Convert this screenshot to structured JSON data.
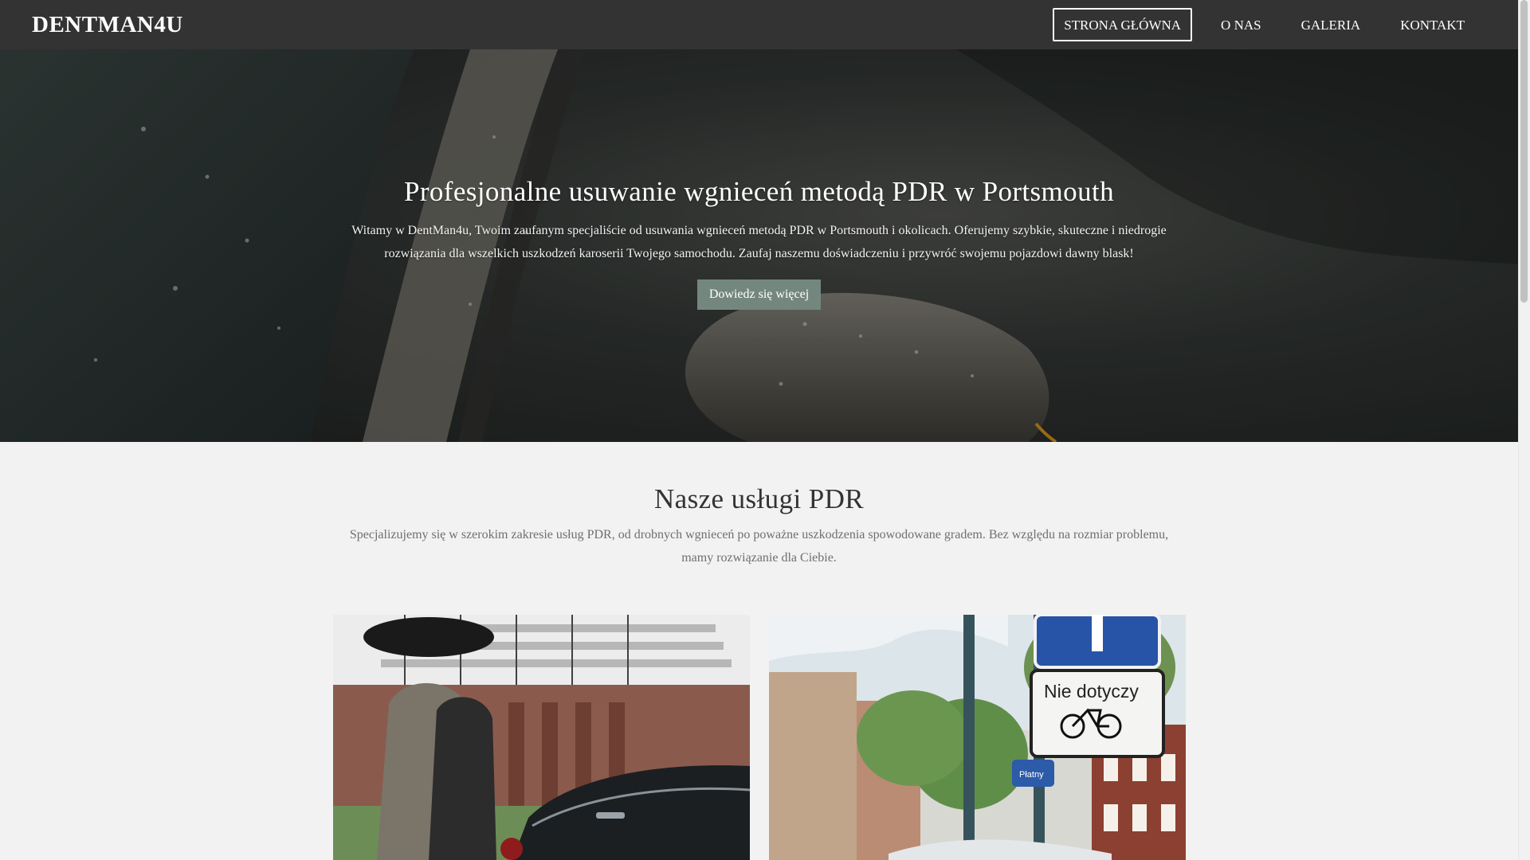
{
  "brand": {
    "name": "DENTMAN4U"
  },
  "nav": {
    "items": [
      {
        "label": "STRONA GŁÓWNA",
        "active": true
      },
      {
        "label": "O NAS",
        "active": false
      },
      {
        "label": "GALERIA",
        "active": false
      },
      {
        "label": "KONTAKT",
        "active": false
      }
    ]
  },
  "hero": {
    "title": "Profesjonalne usuwanie wgnieceń metodą PDR w Portsmouth",
    "text": "Witamy w DentMan4u, Twoim zaufanym specjaliście od usuwania wgnieceń metodą PDR w Portsmouth i okolicach. Oferujemy szybkie, skuteczne i niedrogie rozwiązania dla wszelkich uszkodzeń karoserii Twojego samochodu. Zaufaj naszemu doświadczeniu i przywróć swojemu pojazdowi dawny blask!",
    "button_label": "Dowiedz się więcej",
    "background_icon": "car-side-mirror-rain-photo"
  },
  "services": {
    "title": "Nasze usługi PDR",
    "text": "Specjalizujemy się w szerokim zakresie usług PDR, od drobnych wgnieceń po poważne uszkodzenia spowodowane gradem. Bez względu na rozmiar problemu, mamy rozwiązanie dla Ciebie.",
    "cards": [
      {
        "image_icon": "people-umbrella-car-photo"
      },
      {
        "image_icon": "street-sign-photo",
        "sign_text": "Nie dotyczy",
        "sign_subtext": "Płatny"
      }
    ]
  },
  "colors": {
    "navbar": "#333333",
    "accent_button": "#74877f",
    "page_bg": "#f2f2f2",
    "heading": "#333333",
    "body_text": "#6f6f6f"
  }
}
